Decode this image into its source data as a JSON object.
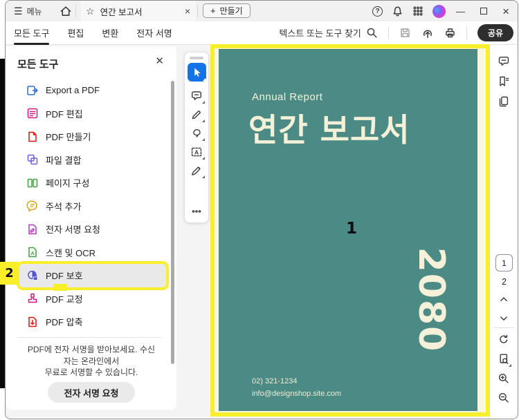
{
  "titlebar": {
    "menu_label": "메뉴",
    "tab_title": "연간 보고서",
    "create_label": "만들기"
  },
  "ribbon": {
    "tabs": [
      {
        "name": "all-tools",
        "label": "모든 도구"
      },
      {
        "name": "edit",
        "label": "편집"
      },
      {
        "name": "convert",
        "label": "변환"
      },
      {
        "name": "e-sign",
        "label": "전자 서명"
      }
    ],
    "active_tab": 0,
    "search_label": "텍스트 또는 도구 찾기",
    "share_label": "공유"
  },
  "tools_panel": {
    "title": "모든 도구",
    "items": [
      {
        "label": "Export a PDF",
        "icon": "export-pdf",
        "color": "#2a6fdb",
        "highlighted": false
      },
      {
        "label": "PDF 편집",
        "icon": "pdf-edit",
        "color": "#d6187e",
        "highlighted": false
      },
      {
        "label": "PDF 만들기",
        "icon": "pdf-create",
        "color": "#e3120b",
        "highlighted": false
      },
      {
        "label": "파일 결합",
        "icon": "combine-files",
        "color": "#6e5be8",
        "highlighted": false
      },
      {
        "label": "페이지 구성",
        "icon": "organize-pages",
        "color": "#3da33f",
        "highlighted": false
      },
      {
        "label": "주석 추가",
        "icon": "add-comments",
        "color": "#d9a514",
        "highlighted": false
      },
      {
        "label": "전자 서명 요청",
        "icon": "request-esign",
        "color": "#bb30c9",
        "highlighted": false
      },
      {
        "label": "스캔 및 OCR",
        "icon": "scan-ocr",
        "color": "#3da33f",
        "highlighted": false
      },
      {
        "label": "PDF 보호",
        "icon": "protect-pdf",
        "color": "#4f55d8",
        "highlighted": true
      },
      {
        "label": "PDF 교정",
        "icon": "redact-pdf",
        "color": "#d6187e",
        "highlighted": false
      },
      {
        "label": "PDF 압축",
        "icon": "compress-pdf",
        "color": "#e3120b",
        "highlighted": false
      }
    ],
    "promo_lines": [
      "PDF에 전자 서명을 받아보세요. 수신",
      "자는 온라인에서",
      "무료로 서명할 수 있습니다."
    ],
    "promo_button": "전자 서명 요청"
  },
  "document": {
    "eyebrow": "Annual Report",
    "title": "연간 보고서",
    "year": "2080",
    "phone": "02) 321-1234",
    "email": "info@designshop.site.com"
  },
  "page_nav": {
    "current_page": "1",
    "total_pages": "2"
  },
  "annotations": {
    "step_document": "1",
    "step_protect": "2",
    "highlight_color": "#f7ef2b"
  },
  "icons": {
    "hamburger": "☰",
    "star": "☆",
    "tab_close": "×",
    "plus": "+",
    "help": "?",
    "minimize": "—",
    "window_close": "×",
    "panel_close": "✕",
    "more_dots": "···"
  },
  "colors": {
    "accent_blue": "#1473e6",
    "page_teal": "#4c8b85",
    "cream_text": "#f4f1d8",
    "share_button_bg": "#2e2e2e",
    "highlight_row_bg": "#e9e9e9"
  }
}
